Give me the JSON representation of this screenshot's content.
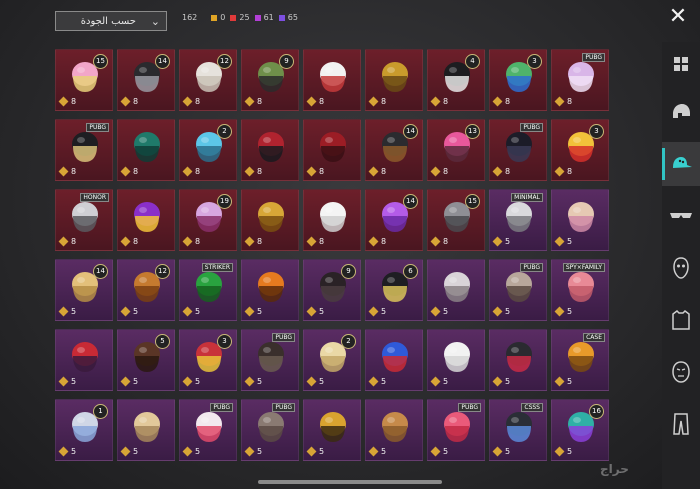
{
  "header": {
    "sort_label": "حسب الجودة",
    "total": "162",
    "counts": [
      {
        "value": "0",
        "color": "#e0a526"
      },
      {
        "value": "25",
        "color": "#e03a3a"
      },
      {
        "value": "61",
        "color": "#b23fd6"
      },
      {
        "value": "65",
        "color": "#7d4fe0"
      }
    ]
  },
  "sidebar": {
    "items": [
      {
        "name": "all-items",
        "icon": "grid-icon"
      },
      {
        "name": "helmets",
        "icon": "helmet-icon"
      },
      {
        "name": "hats",
        "icon": "cap-icon",
        "active": true
      },
      {
        "name": "glasses",
        "icon": "glasses-icon"
      },
      {
        "name": "masks",
        "icon": "mask-icon"
      },
      {
        "name": "tops",
        "icon": "shirt-icon"
      },
      {
        "name": "faces",
        "icon": "face-icon"
      },
      {
        "name": "pants",
        "icon": "pants-icon"
      }
    ]
  },
  "items": [
    {
      "rarity": "red",
      "qty": "8",
      "badge": "15",
      "art": "hair-pink"
    },
    {
      "rarity": "red",
      "qty": "8",
      "badge": "14",
      "art": "mask-dark"
    },
    {
      "rarity": "red",
      "qty": "8",
      "badge": "12",
      "art": "hair-white"
    },
    {
      "rarity": "red",
      "qty": "8",
      "badge": "9",
      "art": "zombie"
    },
    {
      "rarity": "red",
      "qty": "8",
      "badge": "",
      "art": "cowboy-white"
    },
    {
      "rarity": "red",
      "qty": "8",
      "badge": "",
      "art": "gold-helm"
    },
    {
      "rarity": "red",
      "qty": "8",
      "badge": "4",
      "art": "top-hat"
    },
    {
      "rarity": "red",
      "qty": "8",
      "badge": "3",
      "art": "green-skull"
    },
    {
      "rarity": "red",
      "qty": "8",
      "tag": "PUBG",
      "art": "hair-lilac"
    },
    {
      "rarity": "red",
      "qty": "8",
      "tag": "PUBG",
      "art": "samurai"
    },
    {
      "rarity": "red",
      "qty": "8",
      "badge": "",
      "art": "green-mask"
    },
    {
      "rarity": "red",
      "qty": "8",
      "badge": "2",
      "art": "blue-helm"
    },
    {
      "rarity": "red",
      "qty": "8",
      "badge": "",
      "art": "red-horn"
    },
    {
      "rarity": "red",
      "qty": "8",
      "badge": "",
      "art": "red-helm"
    },
    {
      "rarity": "red",
      "qty": "8",
      "badge": "14",
      "art": "dark-helm"
    },
    {
      "rarity": "red",
      "qty": "8",
      "badge": "13",
      "art": "pink-dreads"
    },
    {
      "rarity": "red",
      "qty": "8",
      "tag": "PUBG",
      "art": "hood"
    },
    {
      "rarity": "red",
      "qty": "8",
      "badge": "3",
      "art": "fries"
    },
    {
      "rarity": "red",
      "qty": "8",
      "tag": "HONOR",
      "art": "knight"
    },
    {
      "rarity": "red",
      "qty": "8",
      "badge": "",
      "art": "purple-cat"
    },
    {
      "rarity": "red",
      "qty": "8",
      "badge": "19",
      "art": "pink-demon"
    },
    {
      "rarity": "red",
      "qty": "8",
      "badge": "",
      "art": "gold-crown"
    },
    {
      "rarity": "red",
      "qty": "8",
      "badge": "",
      "art": "ghost"
    },
    {
      "rarity": "red",
      "qty": "8",
      "badge": "14",
      "art": "purple-gem"
    },
    {
      "rarity": "red",
      "qty": "8",
      "badge": "15",
      "art": "grey-helm"
    },
    {
      "rarity": "purple",
      "qty": "5",
      "tag": "MINIMAL",
      "art": "camera"
    },
    {
      "rarity": "purple",
      "qty": "5",
      "badge": "",
      "art": "hair-beige"
    },
    {
      "rarity": "purple",
      "qty": "5",
      "badge": "14",
      "art": "hair-blonde"
    },
    {
      "rarity": "purple",
      "qty": "5",
      "badge": "12",
      "art": "dreads-orange"
    },
    {
      "rarity": "purple",
      "qty": "5",
      "tag": "STRIKER",
      "art": "green-hair"
    },
    {
      "rarity": "purple",
      "qty": "5",
      "badge": "",
      "art": "pumpkin"
    },
    {
      "rarity": "purple",
      "qty": "5",
      "badge": "9",
      "art": "hair-black"
    },
    {
      "rarity": "purple",
      "qty": "5",
      "badge": "6",
      "art": "bird-mask"
    },
    {
      "rarity": "purple",
      "qty": "5",
      "badge": "",
      "art": "wolf"
    },
    {
      "rarity": "purple",
      "qty": "5",
      "tag": "PUBG",
      "art": "sack-mask"
    },
    {
      "rarity": "purple",
      "qty": "5",
      "tag": "SPY×FAMILY",
      "art": "hair-pink2"
    },
    {
      "rarity": "purple",
      "qty": "5",
      "badge": "",
      "art": "red-bow"
    },
    {
      "rarity": "purple",
      "qty": "5",
      "badge": "5",
      "art": "hair-brown"
    },
    {
      "rarity": "purple",
      "qty": "5",
      "badge": "3",
      "art": "jester"
    },
    {
      "rarity": "purple",
      "qty": "5",
      "tag": "PUBG",
      "art": "hair-dark"
    },
    {
      "rarity": "purple",
      "qty": "5",
      "badge": "2",
      "art": "hair-blonde2"
    },
    {
      "rarity": "purple",
      "qty": "5",
      "badge": "",
      "art": "blue-mask"
    },
    {
      "rarity": "purple",
      "qty": "5",
      "badge": "",
      "art": "bunny-white"
    },
    {
      "rarity": "purple",
      "qty": "5",
      "badge": "",
      "art": "dark-cap"
    },
    {
      "rarity": "purple",
      "qty": "5",
      "tag": "CASE",
      "art": "orange-blob"
    },
    {
      "rarity": "purple",
      "qty": "5",
      "badge": "1",
      "art": "hair-silver"
    },
    {
      "rarity": "purple",
      "qty": "5",
      "badge": "",
      "art": "paper-bag"
    },
    {
      "rarity": "purple",
      "qty": "5",
      "tag": "PUBG",
      "art": "bunny-plush"
    },
    {
      "rarity": "purple",
      "qty": "5",
      "tag": "PUBG",
      "art": "hair-ash"
    },
    {
      "rarity": "purple",
      "qty": "5",
      "badge": "",
      "art": "gold-mask"
    },
    {
      "rarity": "purple",
      "qty": "5",
      "badge": "",
      "art": "potato"
    },
    {
      "rarity": "purple",
      "qty": "5",
      "tag": "PUBG",
      "art": "pink-bob"
    },
    {
      "rarity": "purple",
      "qty": "5",
      "tag": "CSSS",
      "art": "beanie"
    },
    {
      "rarity": "purple",
      "qty": "5",
      "badge": "16",
      "art": "peacock"
    }
  ],
  "watermark": "حراج"
}
